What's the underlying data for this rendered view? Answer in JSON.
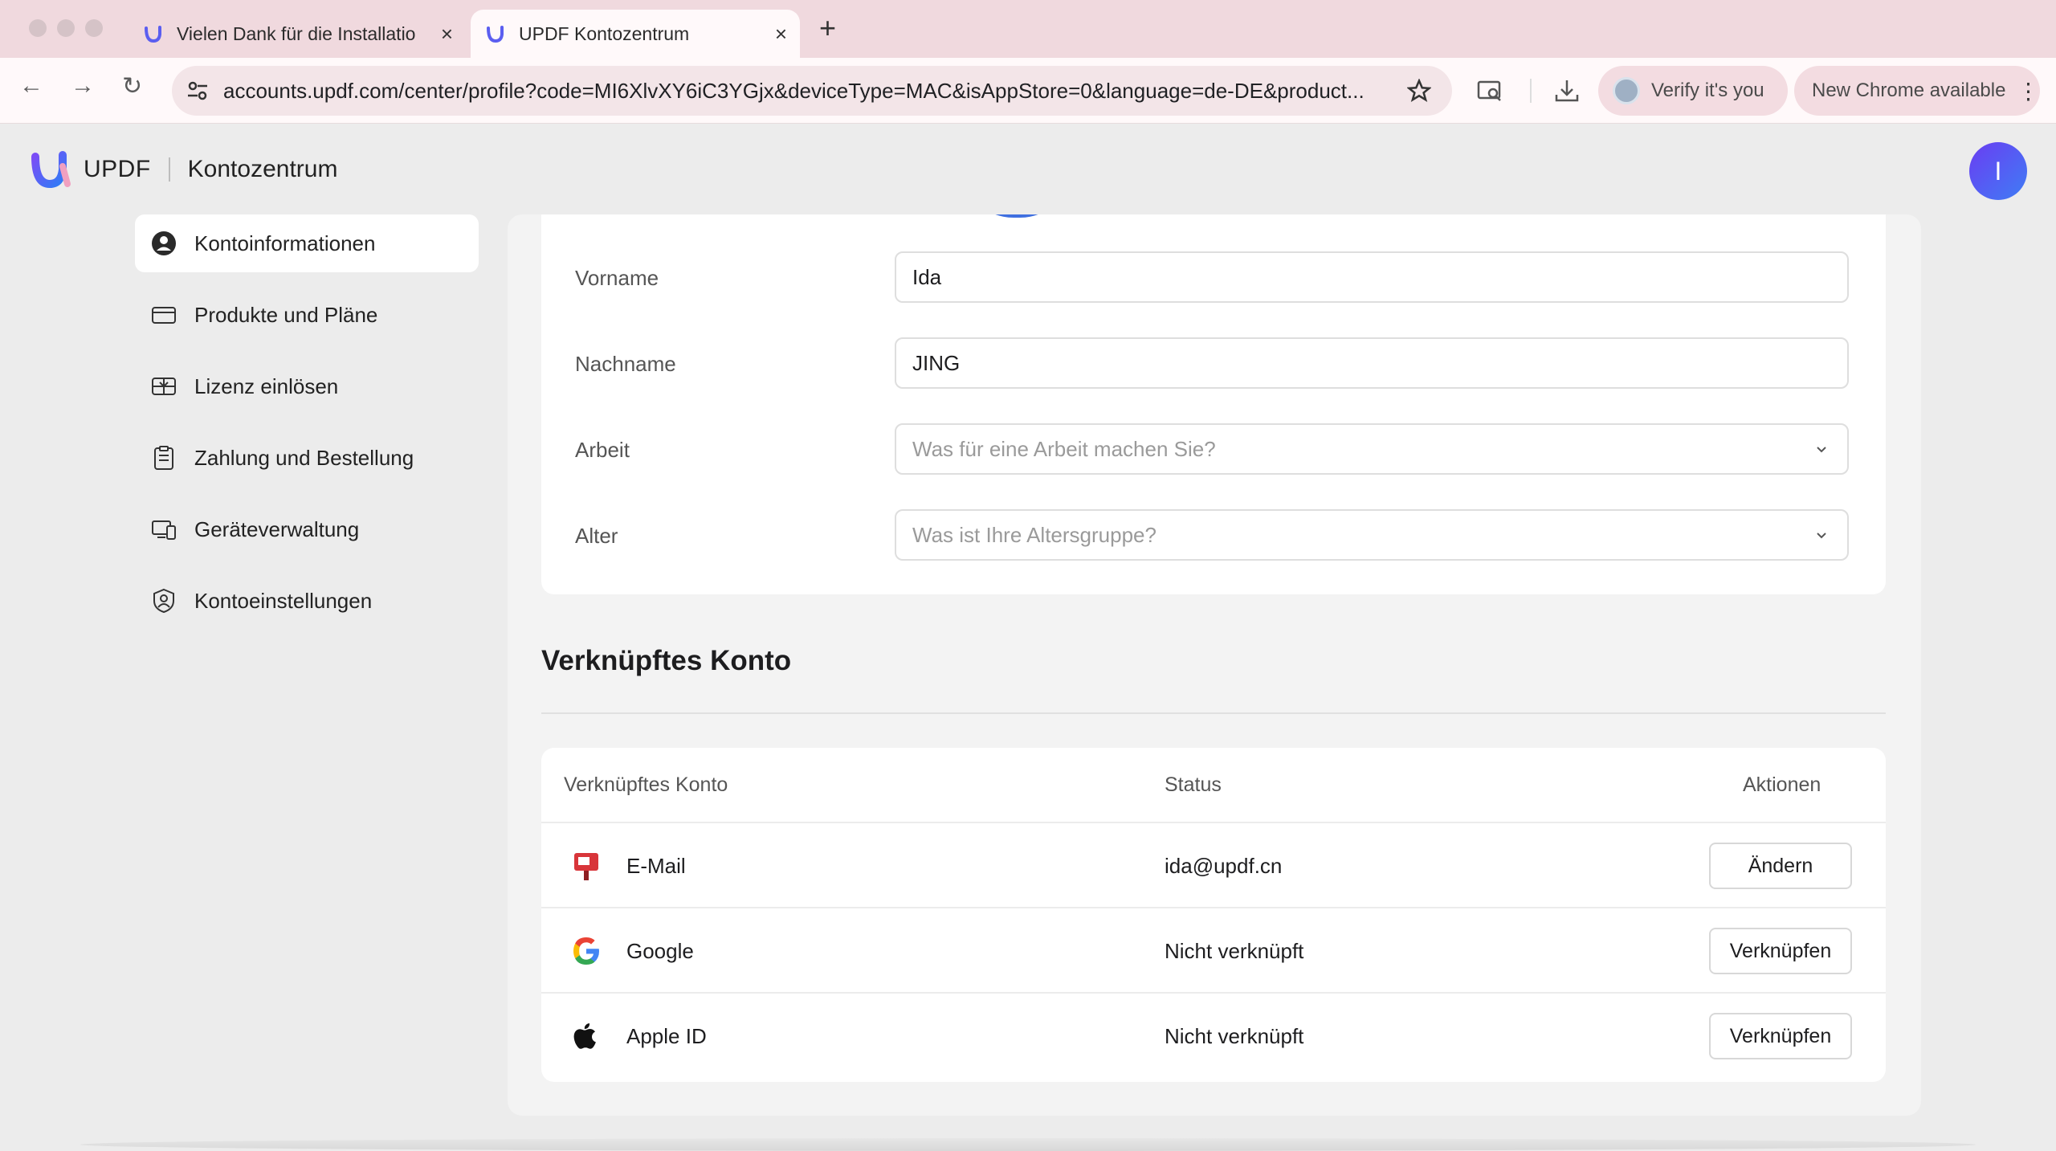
{
  "browser": {
    "tabs": [
      {
        "label": "Vielen Dank für die Installatio",
        "active": false
      },
      {
        "label": "UPDF Kontozentrum",
        "active": true
      }
    ],
    "url": "accounts.updf.com/center/profile?code=MI6XlvXY6iC3YGjx&deviceType=MAC&isAppStore=0&language=de-DE&product...",
    "verify_label": "Verify it's you",
    "update_label": "New Chrome available"
  },
  "header": {
    "brand": "UPDF",
    "section": "Kontozentrum",
    "avatar_initial": "I"
  },
  "sidebar": {
    "items": [
      {
        "label": "Kontoinformationen",
        "icon": "user-circle-icon",
        "active": true
      },
      {
        "label": "Produkte und Pläne",
        "icon": "card-icon",
        "active": false
      },
      {
        "label": "Lizenz einlösen",
        "icon": "gift-card-icon",
        "active": false
      },
      {
        "label": "Zahlung und Bestellung",
        "icon": "clipboard-icon",
        "active": false
      },
      {
        "label": "Geräteverwaltung",
        "icon": "devices-icon",
        "active": false
      },
      {
        "label": "Kontoeinstellungen",
        "icon": "shield-user-icon",
        "active": false
      }
    ]
  },
  "profile": {
    "fields": [
      {
        "label": "Vorname",
        "value": "Ida",
        "placeholder": "",
        "type": "text"
      },
      {
        "label": "Nachname",
        "value": "JING",
        "placeholder": "",
        "type": "text"
      },
      {
        "label": "Arbeit",
        "value": "",
        "placeholder": "Was für eine Arbeit machen Sie?",
        "type": "select"
      },
      {
        "label": "Alter",
        "value": "",
        "placeholder": "Was ist Ihre Altersgruppe?",
        "type": "select"
      }
    ]
  },
  "linked": {
    "title": "Verknüpftes Konto",
    "columns": [
      "Verknüpftes Konto",
      "Status",
      "Aktionen"
    ],
    "rows": [
      {
        "name": "E-Mail",
        "status": "ida@updf.cn",
        "action": "Ändern",
        "icon": "mailbox-icon"
      },
      {
        "name": "Google",
        "status": "Nicht verknüpft",
        "action": "Verknüpfen",
        "icon": "google-icon"
      },
      {
        "name": "Apple ID",
        "status": "Nicht verknüpft",
        "action": "Verknüpfen",
        "icon": "apple-icon"
      }
    ]
  },
  "colors": {
    "tabbar": "#f0d9de",
    "accent_avatar": "#5a55f0",
    "card": "#ffffff",
    "background": "#ececec"
  }
}
